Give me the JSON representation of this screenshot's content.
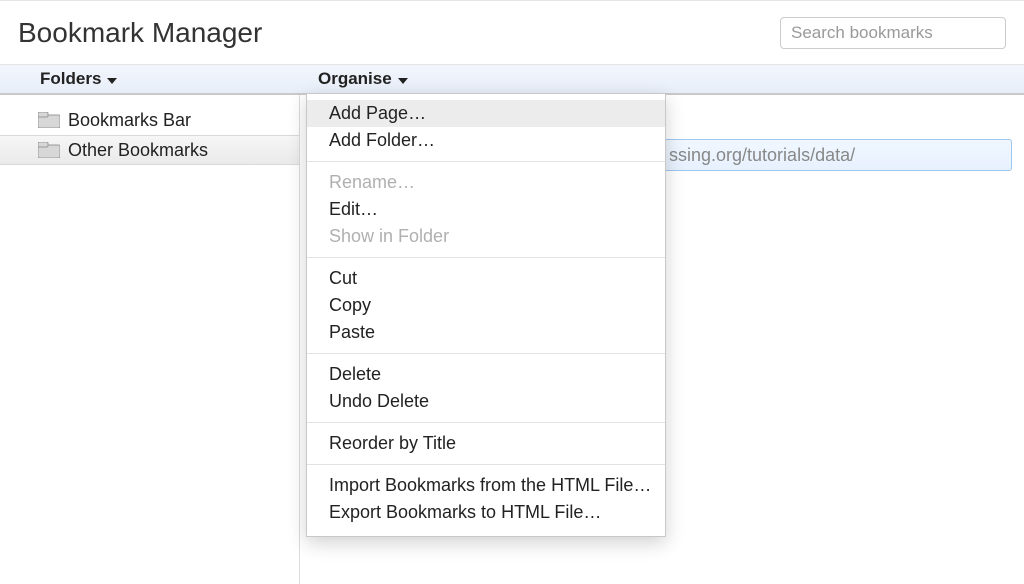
{
  "title": "Bookmark Manager",
  "search": {
    "placeholder": "Search bookmarks",
    "value": ""
  },
  "columns": {
    "folders": "Folders",
    "organise": "Organise"
  },
  "sidebar": {
    "items": [
      {
        "label": "Bookmarks Bar",
        "selected": false
      },
      {
        "label": "Other Bookmarks",
        "selected": true
      }
    ]
  },
  "content": {
    "selected_bookmark_fragment": "ssing.org/tutorials/data/"
  },
  "menu": {
    "groups": [
      [
        {
          "label": "Add Page…",
          "enabled": true,
          "highlight": true
        },
        {
          "label": "Add Folder…",
          "enabled": true
        }
      ],
      [
        {
          "label": "Rename…",
          "enabled": false
        },
        {
          "label": "Edit…",
          "enabled": true
        },
        {
          "label": "Show in Folder",
          "enabled": false
        }
      ],
      [
        {
          "label": "Cut",
          "enabled": true
        },
        {
          "label": "Copy",
          "enabled": true
        },
        {
          "label": "Paste",
          "enabled": true
        }
      ],
      [
        {
          "label": "Delete",
          "enabled": true
        },
        {
          "label": "Undo Delete",
          "enabled": true
        }
      ],
      [
        {
          "label": "Reorder by Title",
          "enabled": true
        }
      ],
      [
        {
          "label": "Import Bookmarks from the HTML File…",
          "enabled": true
        },
        {
          "label": "Export Bookmarks to HTML File…",
          "enabled": true
        }
      ]
    ]
  }
}
